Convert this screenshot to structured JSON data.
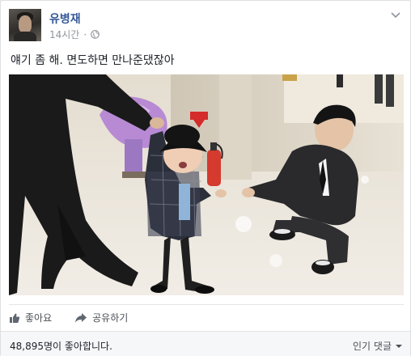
{
  "post": {
    "author": "유병재",
    "time": "14시간",
    "separator": "·",
    "text": "얘기 좀 해. 면도하면 만나준댔잖아",
    "photo_alt": "Crying toddler being led by adults in a hall"
  },
  "actions": {
    "like_label": "좋아요",
    "share_label": "공유하기"
  },
  "footer": {
    "likes_text": "48,895명이 좋아합니다.",
    "sort_label": "인기 댓글"
  },
  "icons": {
    "audience": "globe-icon",
    "menu": "chevron-down-icon",
    "like": "thumbs-up-icon",
    "share": "share-arrow-icon"
  },
  "colors": {
    "author_link": "#365899",
    "meta": "#90949c",
    "action_text": "#4b4f56"
  }
}
